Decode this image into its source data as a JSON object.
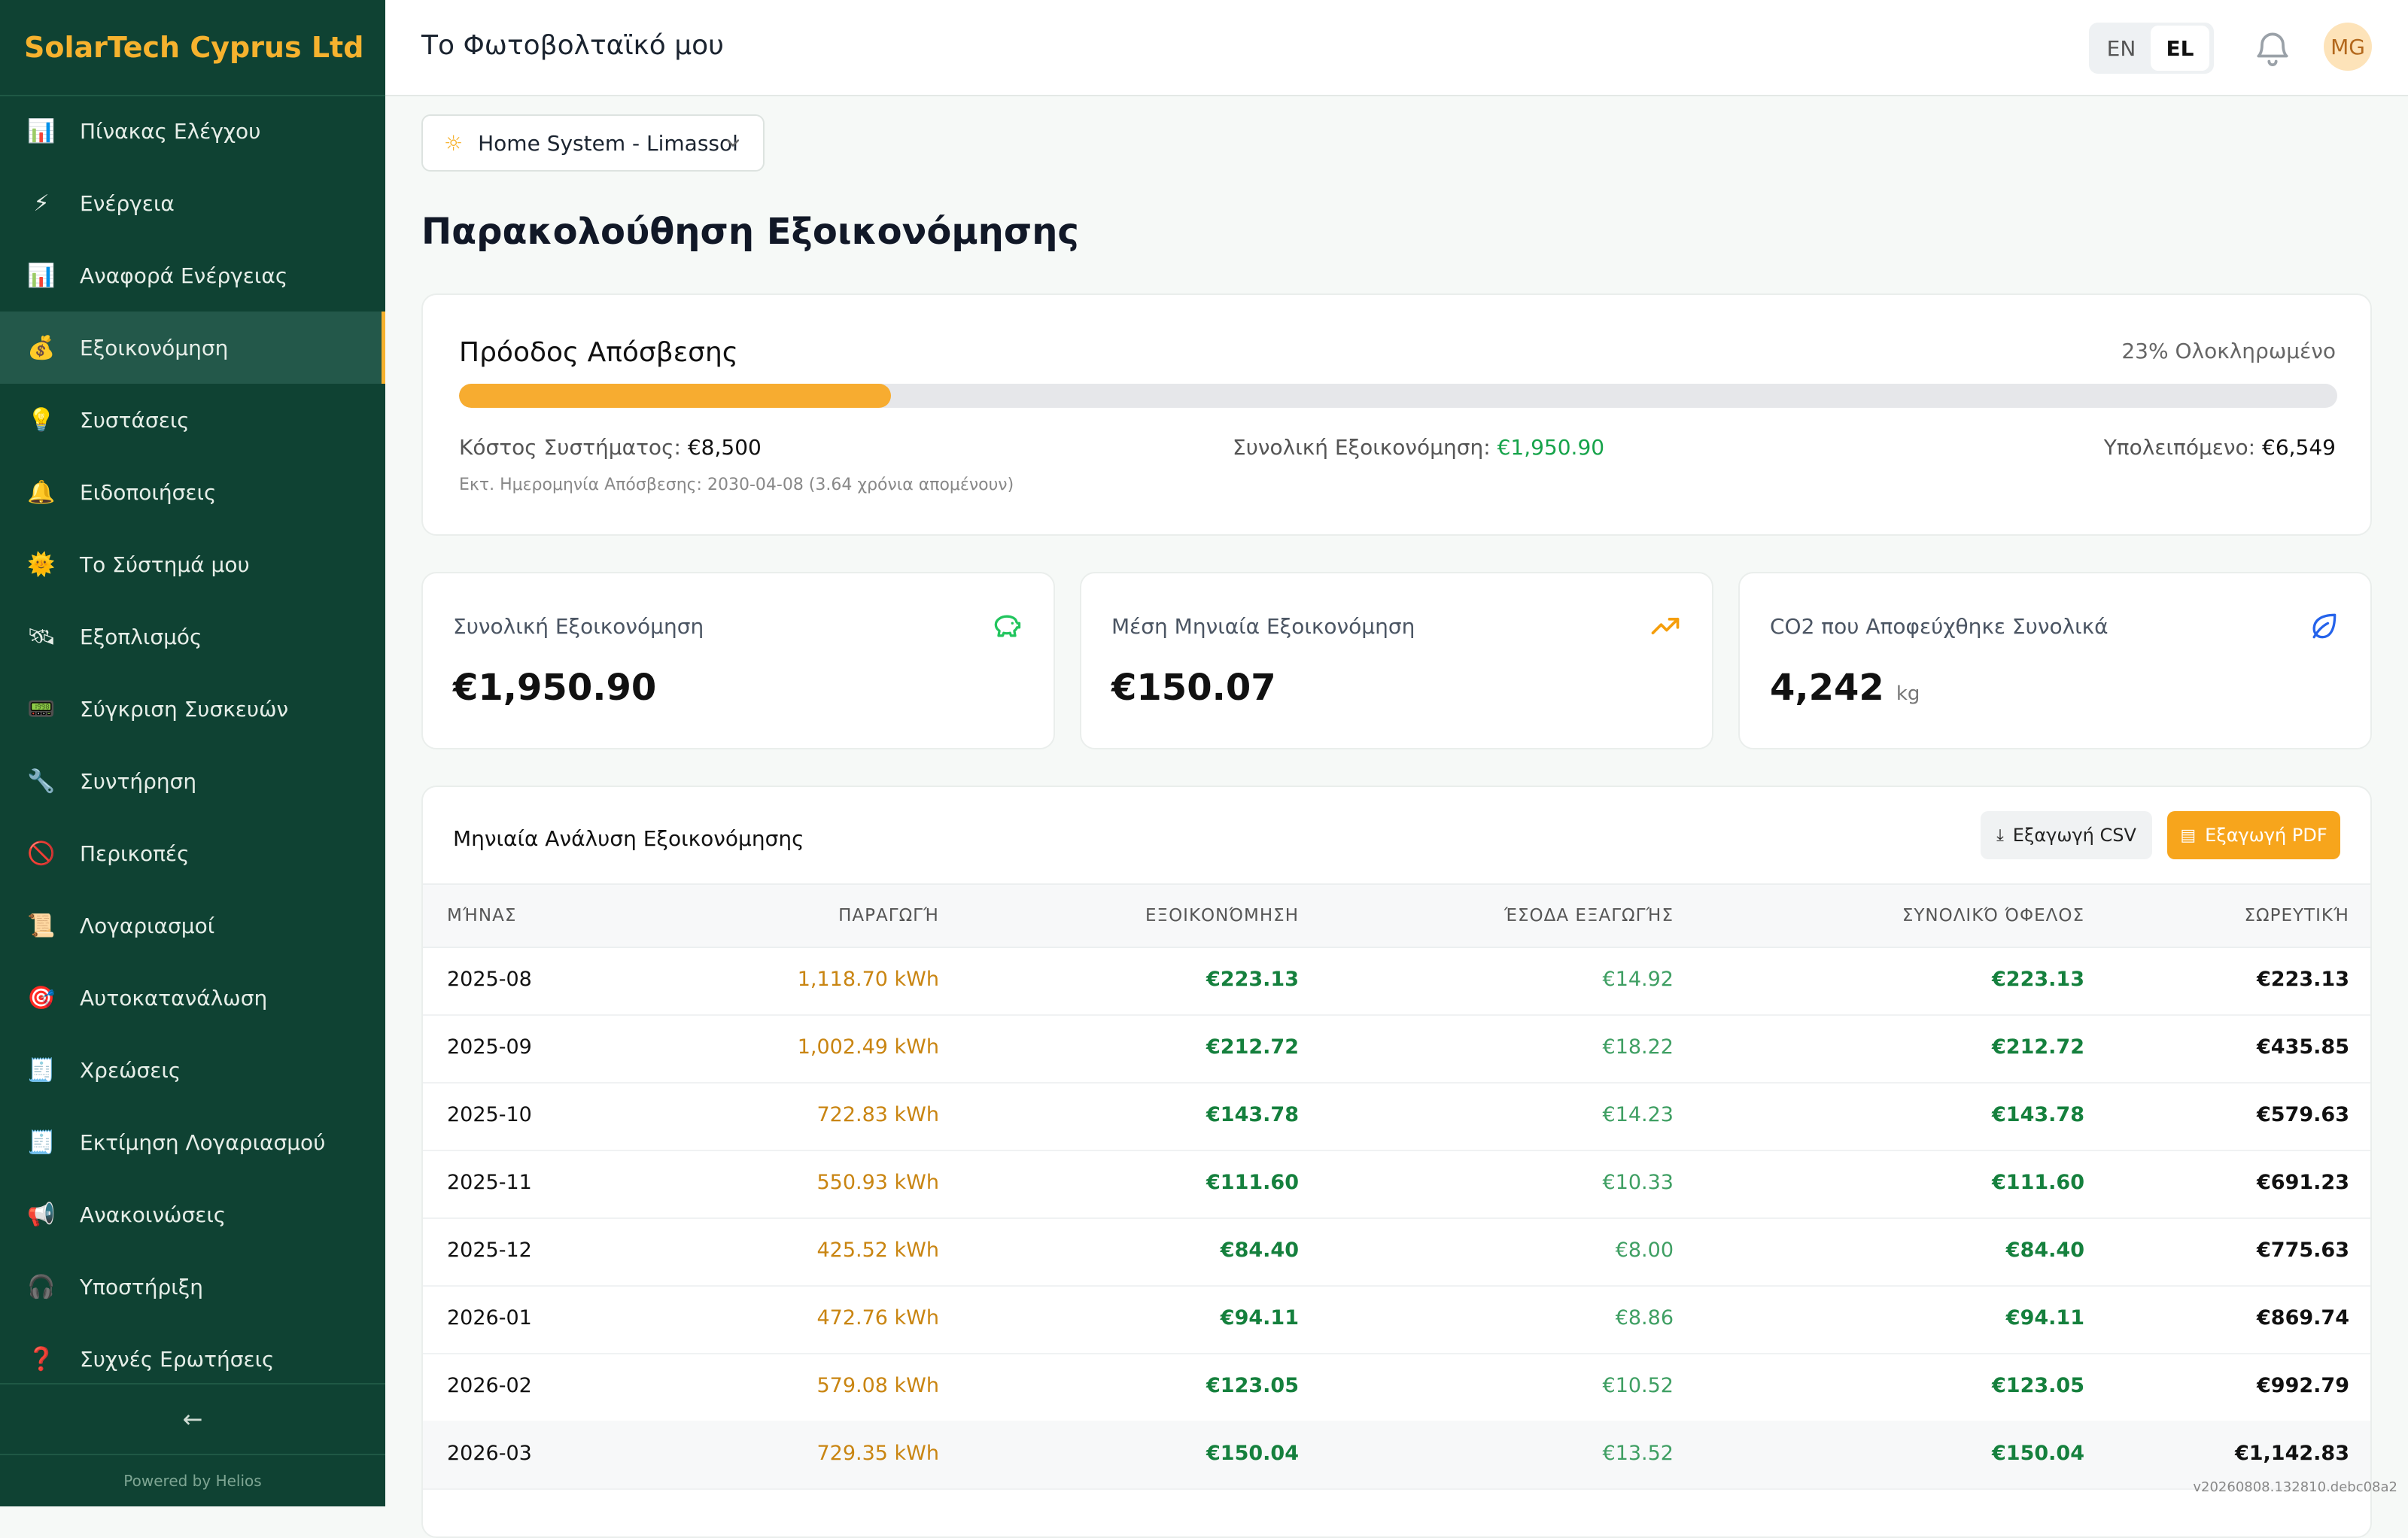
{
  "brand": "SolarTech Cyprus Ltd",
  "sidebar": {
    "items": [
      {
        "icon": "📊",
        "label": "Πίνακας Ελέγχου"
      },
      {
        "icon": "⚡",
        "label": "Ενέργεια"
      },
      {
        "icon": "📊",
        "label": "Αναφορά Ενέργειας"
      },
      {
        "icon": "💰",
        "label": "Εξοικονόμηση"
      },
      {
        "icon": "💡",
        "label": "Συστάσεις"
      },
      {
        "icon": "🔔",
        "label": "Ειδοποιήσεις"
      },
      {
        "icon": "🌞",
        "label": "Το Σύστημά μου"
      },
      {
        "icon": "🛰",
        "label": "Εξοπλισμός"
      },
      {
        "icon": "📟",
        "label": "Σύγκριση Συσκευών"
      },
      {
        "icon": "🔧",
        "label": "Συντήρηση"
      },
      {
        "icon": "🚫",
        "label": "Περικοπές"
      },
      {
        "icon": "📜",
        "label": "Λογαριασμοί"
      },
      {
        "icon": "🎯",
        "label": "Αυτοκατανάλωση"
      },
      {
        "icon": "🧾",
        "label": "Χρεώσεις"
      },
      {
        "icon": "🧾",
        "label": "Εκτίμηση Λογαριασμού"
      },
      {
        "icon": "📢",
        "label": "Ανακοινώσεις"
      },
      {
        "icon": "🎧",
        "label": "Υποστήριξη"
      },
      {
        "icon": "❓",
        "label": "Συχνές Ερωτήσεις"
      }
    ],
    "active_index": 3,
    "collapse_label": "←",
    "powered_by": "Powered by Helios"
  },
  "header": {
    "title": "Το Φωτοβολταϊκό μου",
    "lang_en": "EN",
    "lang_el": "EL",
    "avatar_initials": "MG"
  },
  "system_select": {
    "value": "Home System - Limassol"
  },
  "page_title": "Παρακολούθηση Εξοικονόμησης",
  "payback": {
    "title": "Πρόοδος Απόσβεσης",
    "percent_label": "23% Ολοκληρωμένο",
    "progress": 0.23,
    "cost_label": "Κόστος Συστήματος:",
    "cost_value": "€8,500",
    "savings_label": "Συνολική Εξοικονόμηση:",
    "savings_value": "€1,950.90",
    "remaining_label": "Υπολειπόμενο:",
    "remaining_value": "€6,549",
    "note": "Εκτ. Ημερομηνία Απόσβεσης: 2030-04-08 (3.64 χρόνια απομένουν)"
  },
  "stats": {
    "total": {
      "label": "Συνολική Εξοικονόμηση",
      "value": "€1,950.90",
      "icon": "piggy-bank-icon"
    },
    "monthly": {
      "label": "Μέση Μηνιαία Εξοικονόμηση",
      "value": "€150.07",
      "icon": "trending-up-icon"
    },
    "co2": {
      "label": "CO2 που Αποφεύχθηκε Συνολικά",
      "value": "4,242",
      "unit": "kg",
      "icon": "leaf-icon"
    }
  },
  "table": {
    "title": "Μηνιαία Ανάλυση Εξοικονόμησης",
    "export_csv": "Εξαγωγή CSV",
    "export_pdf": "Εξαγωγή PDF",
    "columns": [
      "ΜΉΝΑΣ",
      "ΠΑΡΑΓΩΓΉ",
      "ΕΞΟΙΚΟΝΌΜΗΣΗ",
      "ΈΣΟΔΑ ΕΞΑΓΩΓΉΣ",
      "ΣΥΝΟΛΙΚΌ ΌΦΕΛΟΣ",
      "ΣΩΡΕΥΤΙΚΉ"
    ],
    "rows": [
      {
        "month": "2025-08",
        "production": "1,118.70 kWh",
        "savings": "€223.13",
        "export": "€14.92",
        "total": "€223.13",
        "cumulative": "€223.13"
      },
      {
        "month": "2025-09",
        "production": "1,002.49 kWh",
        "savings": "€212.72",
        "export": "€18.22",
        "total": "€212.72",
        "cumulative": "€435.85"
      },
      {
        "month": "2025-10",
        "production": "722.83 kWh",
        "savings": "€143.78",
        "export": "€14.23",
        "total": "€143.78",
        "cumulative": "€579.63"
      },
      {
        "month": "2025-11",
        "production": "550.93 kWh",
        "savings": "€111.60",
        "export": "€10.33",
        "total": "€111.60",
        "cumulative": "€691.23"
      },
      {
        "month": "2025-12",
        "production": "425.52 kWh",
        "savings": "€84.40",
        "export": "€8.00",
        "total": "€84.40",
        "cumulative": "€775.63"
      },
      {
        "month": "2026-01",
        "production": "472.76 kWh",
        "savings": "€94.11",
        "export": "€8.86",
        "total": "€94.11",
        "cumulative": "€869.74"
      },
      {
        "month": "2026-02",
        "production": "579.08 kWh",
        "savings": "€123.05",
        "export": "€10.52",
        "total": "€123.05",
        "cumulative": "€992.79"
      },
      {
        "month": "2026-03",
        "production": "729.35 kWh",
        "savings": "€150.04",
        "export": "€13.52",
        "total": "€150.04",
        "cumulative": "€1,142.83"
      }
    ]
  },
  "version": "v20260808.132810.debc08a2"
}
